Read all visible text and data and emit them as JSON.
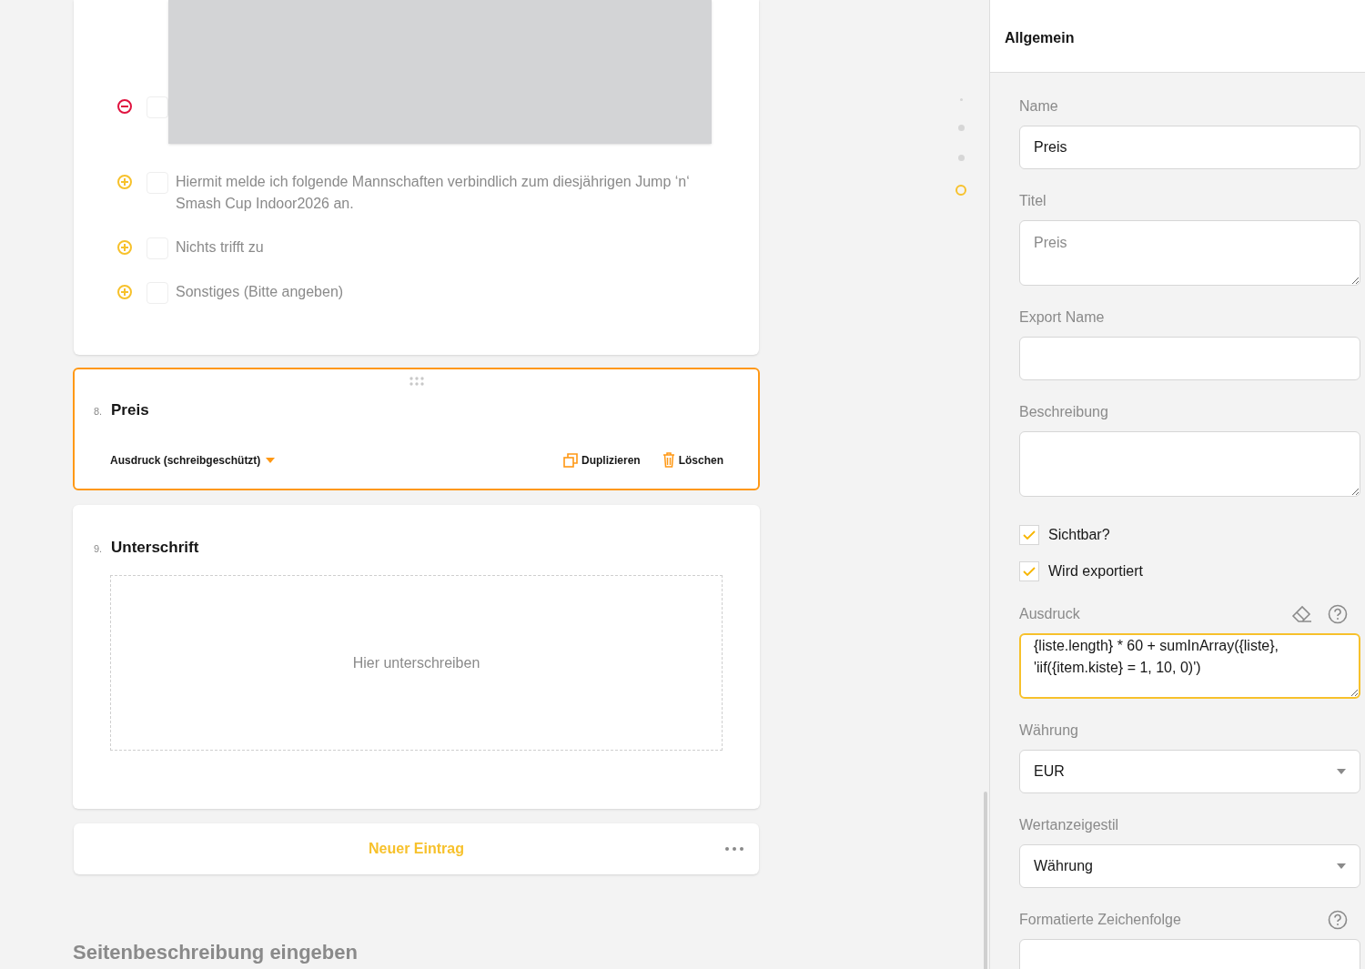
{
  "choices": [
    {
      "kind": "picture",
      "removable": true,
      "checked": false
    },
    {
      "kind": "text",
      "removable": false,
      "checked": false,
      "text": "Hiermit melde ich folgende Mannschaften verbindlich zum diesjährigen Jump ‘n‘ Smash Cup Indoor2026 an."
    },
    {
      "kind": "text",
      "removable": false,
      "checked": false,
      "text": "Nichts trifft zu"
    },
    {
      "kind": "text",
      "removable": false,
      "checked": false,
      "text": "Sonstiges (Bitte angeben)"
    }
  ],
  "questions": [
    {
      "kind": "expression",
      "number": "8.",
      "title": "Preis",
      "selected": true,
      "type_label": "Ausdruck (schreibgeschützt)",
      "actions": [
        "Duplizieren",
        "Löschen"
      ]
    },
    {
      "kind": "signature",
      "number": "9.",
      "title": "Unterschrift",
      "selected": false,
      "placeholder": "Hier unterschreiben"
    }
  ],
  "new_entry": "Neuer Eintrag",
  "page_description": "Seitenbeschreibung eingeben",
  "navigator": [
    {
      "kind": "small",
      "selected": false
    },
    {
      "kind": "dot",
      "selected": false
    },
    {
      "kind": "dot",
      "selected": false
    },
    {
      "kind": "dot",
      "selected": true
    }
  ],
  "panel": {
    "title": "Allgemein",
    "fields": [
      {
        "kind": "input",
        "label": "Name",
        "value": "Preis"
      },
      {
        "kind": "textarea",
        "label": "Titel",
        "placeholder": "Preis"
      },
      {
        "kind": "input",
        "label": "Export Name"
      },
      {
        "kind": "textarea",
        "label": "Beschreibung"
      },
      {
        "kind": "checkbox",
        "label": "Sichtbar?",
        "checked": true
      },
      {
        "kind": "checkbox",
        "label": "Wird exportiert",
        "checked": true
      },
      {
        "kind": "expression",
        "label": "Ausdruck",
        "value": "{liste.length} * 60 + sumInArray({liste}, 'iif({item.kiste} = 1, 10, 0)')",
        "clear": true,
        "help": true
      },
      {
        "kind": "select",
        "label": "Währung",
        "value": "EUR"
      },
      {
        "kind": "select",
        "label": "Wertanzeigestil",
        "value": "Währung"
      },
      {
        "kind": "input",
        "label": "Formatierte Zeichenfolge",
        "help": true
      }
    ]
  }
}
